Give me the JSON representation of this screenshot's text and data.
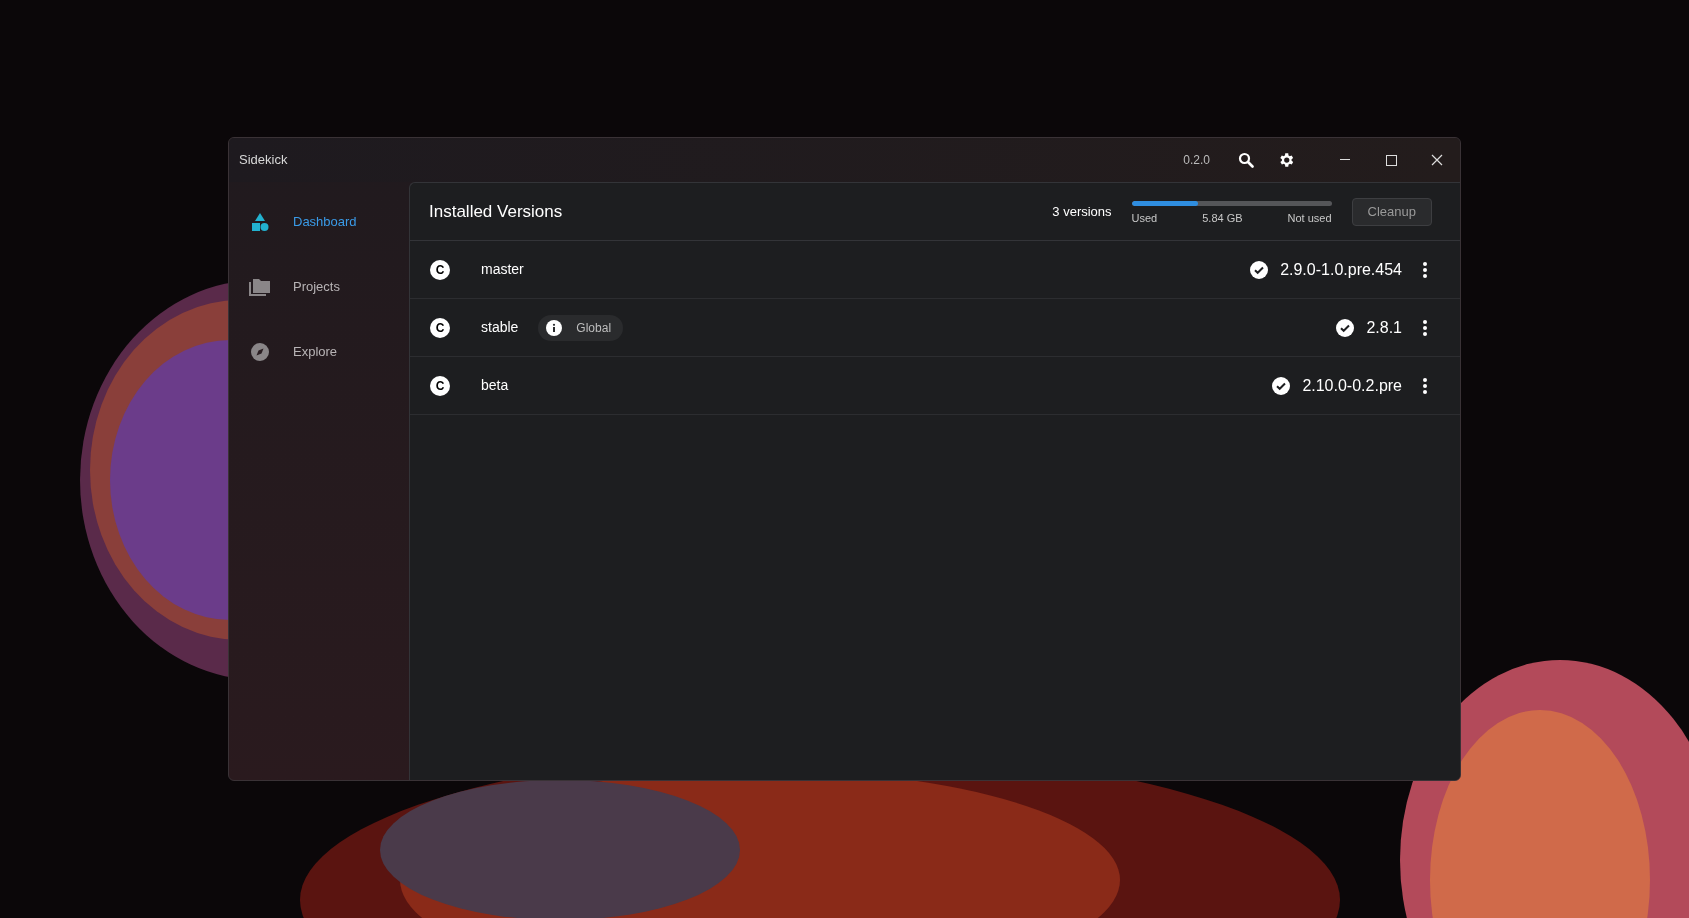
{
  "window": {
    "title": "Sidekick",
    "version": "0.2.0"
  },
  "sidebar": {
    "items": [
      {
        "label": "Dashboard",
        "kind": "dashboard",
        "selected": true
      },
      {
        "label": "Projects",
        "kind": "projects",
        "selected": false
      },
      {
        "label": "Explore",
        "kind": "explore",
        "selected": false
      }
    ]
  },
  "installed_versions": {
    "title": "Installed Versions",
    "count": "3 versions",
    "storage": {
      "level": 0.33,
      "used_label": "Used",
      "size": "5.84 GB",
      "not_used_label": "Not used"
    },
    "cleanup_button": "Cleanup",
    "rows": [
      {
        "channel_letter": "C",
        "name": "master",
        "version": "2.9.0-1.0.pre.454"
      },
      {
        "channel_letter": "C",
        "name": "stable",
        "badge": "Global",
        "version": "2.8.1"
      },
      {
        "channel_letter": "C",
        "name": "beta",
        "version": "2.10.0-0.2.pre"
      }
    ]
  }
}
